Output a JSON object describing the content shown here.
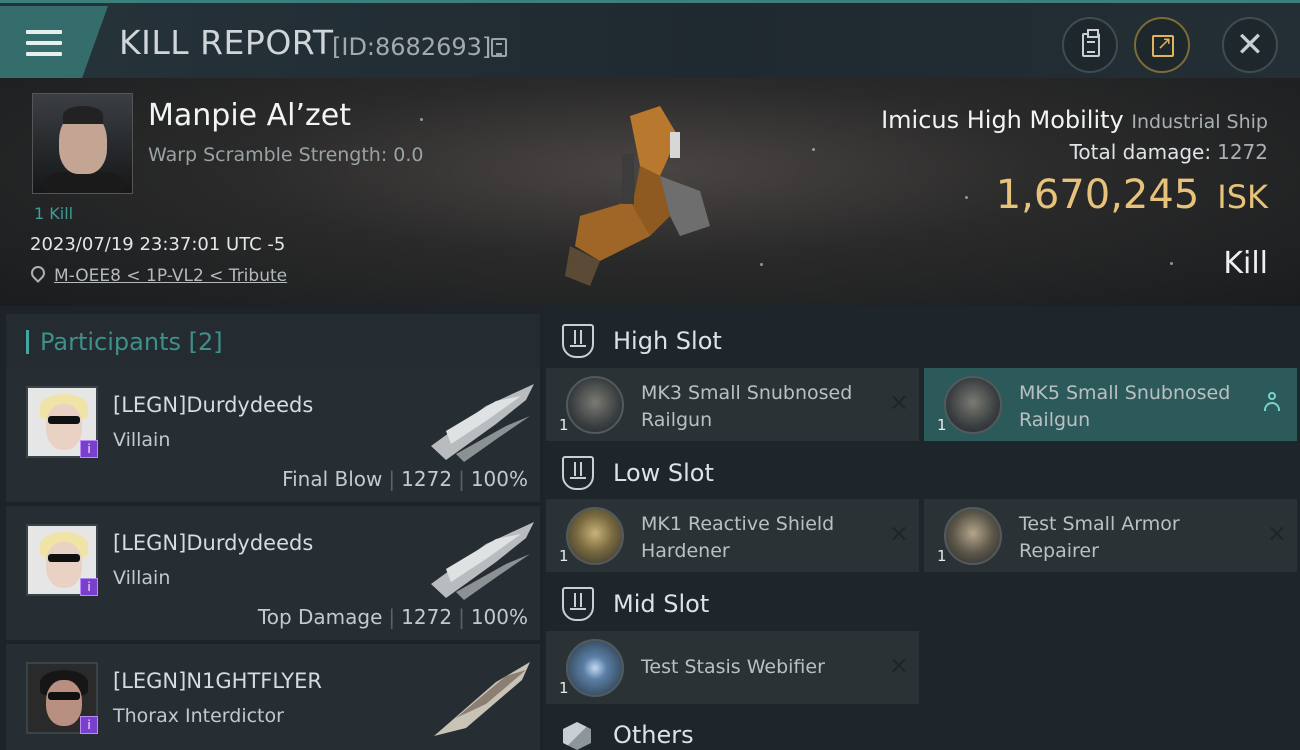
{
  "header": {
    "title": "KILL REPORT",
    "report_id": "[ID:8682693]"
  },
  "victim": {
    "name": "Manpie Al’zet",
    "warp_scramble": "Warp Scramble Strength: 0.0",
    "kills": "1 Kill",
    "datetime": "2023/07/19 23:37:01 UTC -5",
    "location": "M-OEE8 < 1P-VL2 < Tribute",
    "ship_name": "Imicus High Mobility",
    "ship_class": "Industrial Ship",
    "total_damage_label": "Total damage:",
    "total_damage": "1272",
    "isk_value": "1,670,245",
    "isk_unit": "ISK",
    "result": "Kill"
  },
  "participants": {
    "title": "Participants [2]",
    "rows": [
      {
        "name": "[LEGN]Durdydeeds",
        "ship": "Villain",
        "role": "Final Blow",
        "damage": "1272",
        "percent": "100%",
        "badge": "i"
      },
      {
        "name": "[LEGN]Durdydeeds",
        "ship": "Villain",
        "role": "Top Damage",
        "damage": "1272",
        "percent": "100%",
        "badge": "i"
      },
      {
        "name": "[LEGN]N1GHTFLYER",
        "ship": "Thorax Interdictor",
        "badge": "i"
      }
    ]
  },
  "fittings": {
    "high_slot": {
      "label": "High Slot",
      "modules": [
        {
          "name": "MK3 Small Snubnosed Railgun",
          "qty": "1"
        },
        {
          "name": "MK5 Small Snubnosed Railgun",
          "qty": "1"
        }
      ]
    },
    "low_slot": {
      "label": "Low Slot",
      "modules": [
        {
          "name": "MK1 Reactive Shield Hardener",
          "qty": "1"
        },
        {
          "name": "Test Small Armor Repairer",
          "qty": "1"
        }
      ]
    },
    "mid_slot": {
      "label": "Mid Slot",
      "modules": [
        {
          "name": "Test Stasis Webifier",
          "qty": "1"
        }
      ]
    },
    "others": {
      "label": "Others"
    },
    "destroyed_mark": "×"
  },
  "colors": {
    "accent_teal": "#3d7f7d",
    "isk_gold": "#e6c27a",
    "selected_module": "#2c5a5a",
    "badge_purple": "#7a3fcf"
  },
  "icons": {
    "menu": "menu-icon",
    "copy": "copy-icon",
    "clipboard": "clipboard-icon",
    "share": "share-icon",
    "close": "close-icon",
    "location": "location-pin-icon",
    "slot": "slot-icon",
    "others": "cube-icon",
    "person": "person-icon"
  }
}
